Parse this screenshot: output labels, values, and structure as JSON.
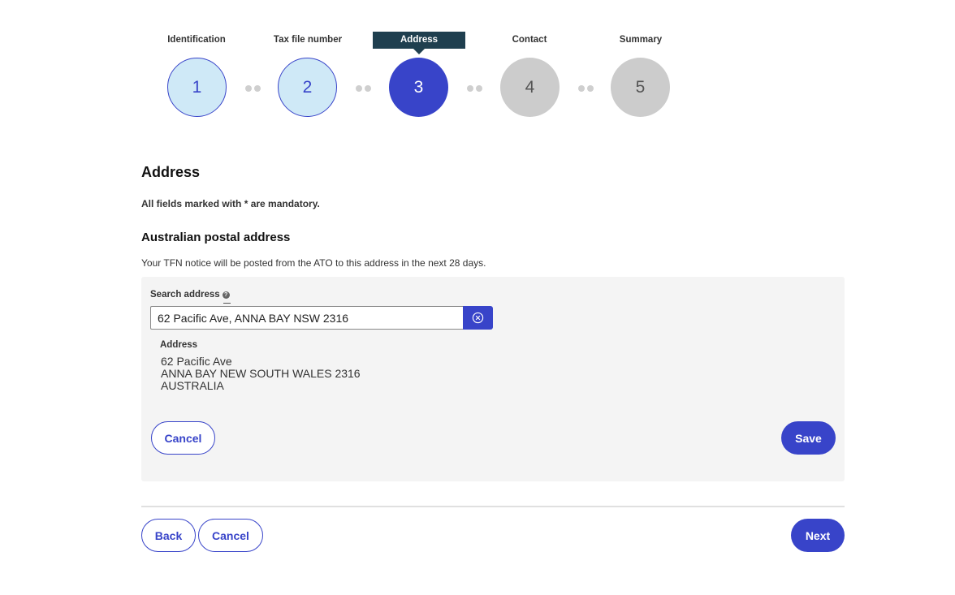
{
  "stepper": {
    "steps": [
      {
        "number": "1",
        "label": "Identification",
        "state": "done"
      },
      {
        "number": "2",
        "label": "Tax file number",
        "state": "done"
      },
      {
        "number": "3",
        "label": "Address",
        "state": "active"
      },
      {
        "number": "4",
        "label": "Contact",
        "state": "todo"
      },
      {
        "number": "5",
        "label": "Summary",
        "state": "todo"
      }
    ]
  },
  "page": {
    "title": "Address",
    "mandatory_note": "All fields marked with * are mandatory.",
    "section_title": "Australian postal address",
    "section_desc": "Your TFN notice will be posted from the ATO to this address in the next 28 days."
  },
  "address_panel": {
    "search_label": "Search address",
    "help_icon": "?",
    "search_value": "62 Pacific Ave, ANNA BAY NSW 2316",
    "clear_icon": "circle-x-icon",
    "address_label": "Address",
    "address_lines": [
      "62 Pacific Ave",
      "ANNA BAY NEW SOUTH WALES 2316",
      "AUSTRALIA"
    ],
    "cancel_label": "Cancel",
    "save_label": "Save"
  },
  "footer": {
    "back_label": "Back",
    "cancel_label": "Cancel",
    "next_label": "Next"
  },
  "colors": {
    "primary": "#3844c9",
    "step_done_bg": "#cfe9f7",
    "step_todo_bg": "#cccccc",
    "tooltip_bg": "#1f3f4f",
    "panel_bg": "#f4f4f4"
  }
}
